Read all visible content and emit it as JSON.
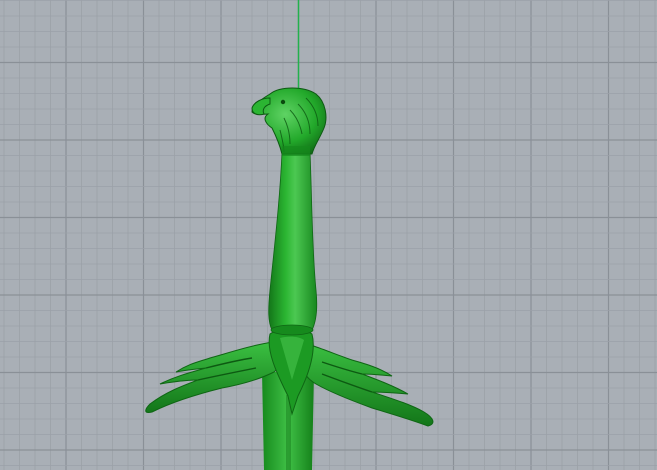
{
  "viewport": {
    "background_color": "#a9afb6",
    "minor_grid_color": "#9ba1a8",
    "major_grid_color": "#8a9097",
    "axis_color": "#22b14c",
    "grid_visible": true,
    "display_mode": "shaded"
  },
  "model": {
    "object": "sword-eagle-pommel",
    "color": "#1fa02a",
    "shadow_color": "#137619",
    "highlight_color": "#4cc852",
    "selected": false
  }
}
